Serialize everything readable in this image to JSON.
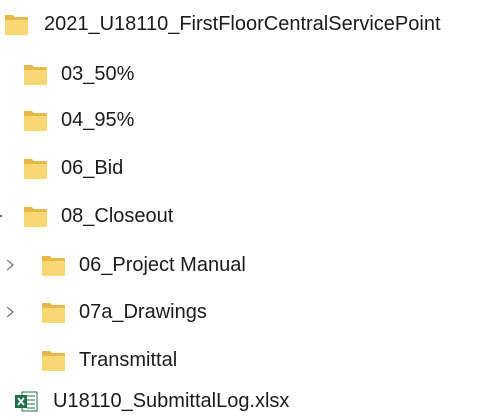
{
  "tree": {
    "root": {
      "label": "2021_U18110_FirstFloorCentralServicePoint",
      "icon": "folder-icon"
    },
    "items": [
      {
        "label": "03_50%",
        "icon": "folder-icon"
      },
      {
        "label": "04_95%",
        "icon": "folder-icon"
      },
      {
        "label": "06_Bid",
        "icon": "folder-icon"
      },
      {
        "label": "08_Closeout",
        "icon": "folder-icon",
        "expanded": true
      },
      {
        "label": "06_Project Manual",
        "icon": "folder-icon",
        "has_children": true,
        "expand_icon": "chevron-right-icon"
      },
      {
        "label": "07a_Drawings",
        "icon": "folder-icon",
        "has_children": true,
        "expand_icon": "chevron-right-icon"
      },
      {
        "label": "Transmittal",
        "icon": "folder-icon"
      },
      {
        "label": "U18110_SubmittalLog.xlsx",
        "icon": "excel-file-icon"
      }
    ]
  },
  "colors": {
    "folder_front": "#F8D775",
    "folder_back": "#E8B84A",
    "excel_green": "#1E7145",
    "chevron": "#808080",
    "text": "#1B1B1B"
  }
}
